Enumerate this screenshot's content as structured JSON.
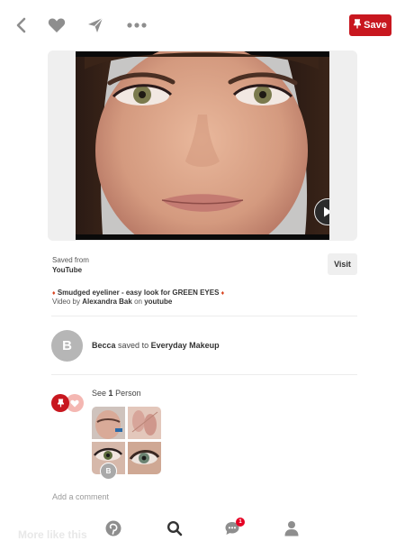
{
  "toolbar": {
    "back_icon": "chevron-left-icon",
    "like_icon": "heart-icon",
    "send_icon": "send-icon",
    "more_icon": "more-dots-icon",
    "save_label": "Save",
    "save_color": "#c8171f"
  },
  "media": {
    "type": "video",
    "play_icon": "play-icon"
  },
  "source": {
    "saved_from_label": "Saved from",
    "site": "YouTube",
    "visit_label": "Visit"
  },
  "pin": {
    "title": "Smudged eyeliner -  easy look for GREEN EYES",
    "byline_prefix": "Video by",
    "author": "Alexandra Bak",
    "byline_mid": "on",
    "platform": "youtube"
  },
  "saver": {
    "avatar_letter": "B",
    "name": "Becca",
    "action": "saved to",
    "board": "Everyday Makeup"
  },
  "people": {
    "prefix": "See",
    "count": "1",
    "suffix": "Person",
    "avatar_letter": "B"
  },
  "comment": {
    "placeholder": "Add a comment"
  },
  "bottom": {
    "ghost_text": "More like this",
    "home_icon": "pinterest-logo-icon",
    "search_icon": "search-icon",
    "chat_icon": "chat-icon",
    "notification_count": "1",
    "profile_icon": "profile-icon"
  }
}
